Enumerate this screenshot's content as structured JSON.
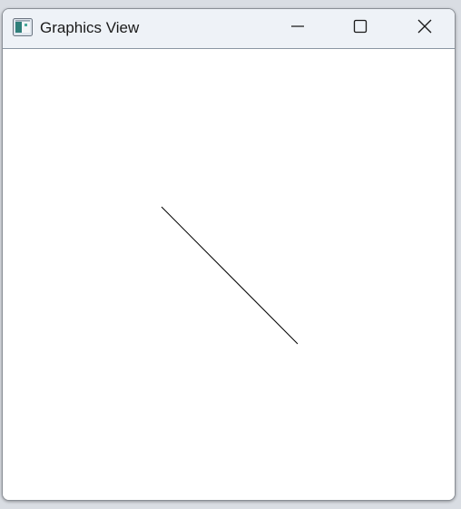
{
  "window": {
    "title": "Graphics View",
    "icon": "app-window-icon",
    "controls": {
      "minimize_icon": "minimize-icon",
      "maximize_icon": "maximize-icon",
      "close_icon": "close-icon"
    }
  },
  "scene": {
    "background_color": "#ffffff",
    "items": [
      {
        "type": "line",
        "stroke_color": "#000000"
      }
    ]
  }
}
